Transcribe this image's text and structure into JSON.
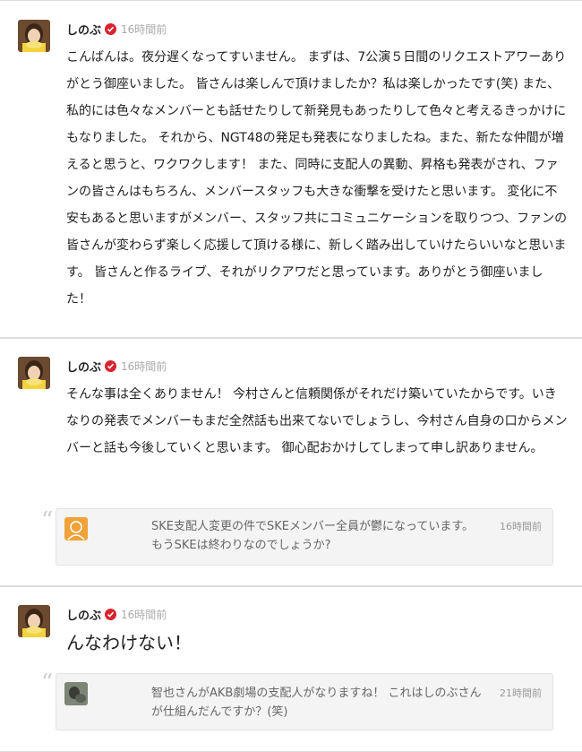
{
  "posts": [
    {
      "author": "しのぶ",
      "time": "16時間前",
      "body": "こんばんは。夜分遅くなってすいません。 まずは、7公演５日間のリクエストアワーありがとう御座いました。 皆さんは楽しんで頂けましたか？私は楽しかったです(笑) また、私的には色々なメンバーとも話せたりして新発見もあったりして色々と考えるきっかけにもなりました。 それから、NGT48の発足も発表になりましたね。また、新たな仲間が増えると思うと、ワクワクします！ また、同時に支配人の異動、昇格も発表がされ、ファンの皆さんはもちろん、メンバースタッフも大きな衝撃を受けたと思います。 変化に不安もあると思いますがメンバー、スタッフ共にコミュニケーションを取りつつ、ファンの皆さんが変わらず楽しく応援して頂ける様に、新しく踏み出していけたらいいなと思います。 皆さんと作るライブ、それがリクアワだと思っています。ありがとう御座いました！"
    },
    {
      "author": "しのぶ",
      "time": "16時間前",
      "body": "そんな事は全くありません！ 今村さんと信頼関係がそれだけ築いていたからです。いきなりの発表でメンバーもまだ全然話も出来てないでしょうし、今村さん自身の口からメンバーと話も今後していくと思います。 御心配おかけしてしまって申し訳ありません。",
      "quote": {
        "text": "SKE支配人変更の件でSKEメンバー全員が鬱になっています。もうSKEは終わりなのでしょうか?",
        "time": "16時間前"
      }
    },
    {
      "author": "しのぶ",
      "time": "16時間前",
      "body": "んなわけない！",
      "quote": {
        "text": "智也さんがAKB劇場の支配人がなりますね！ これはしのぶさんが仕組んだんですか？(笑)",
        "time": "21時間前"
      }
    }
  ],
  "icons": {
    "verified": "verified-badge-icon",
    "quote": "quote-mark-icon",
    "default_avatar": "default-avatar-icon"
  },
  "colors": {
    "verified": "#d9232e",
    "default_avatar_bg": "#f0a23a"
  },
  "quote_glyph": "“"
}
